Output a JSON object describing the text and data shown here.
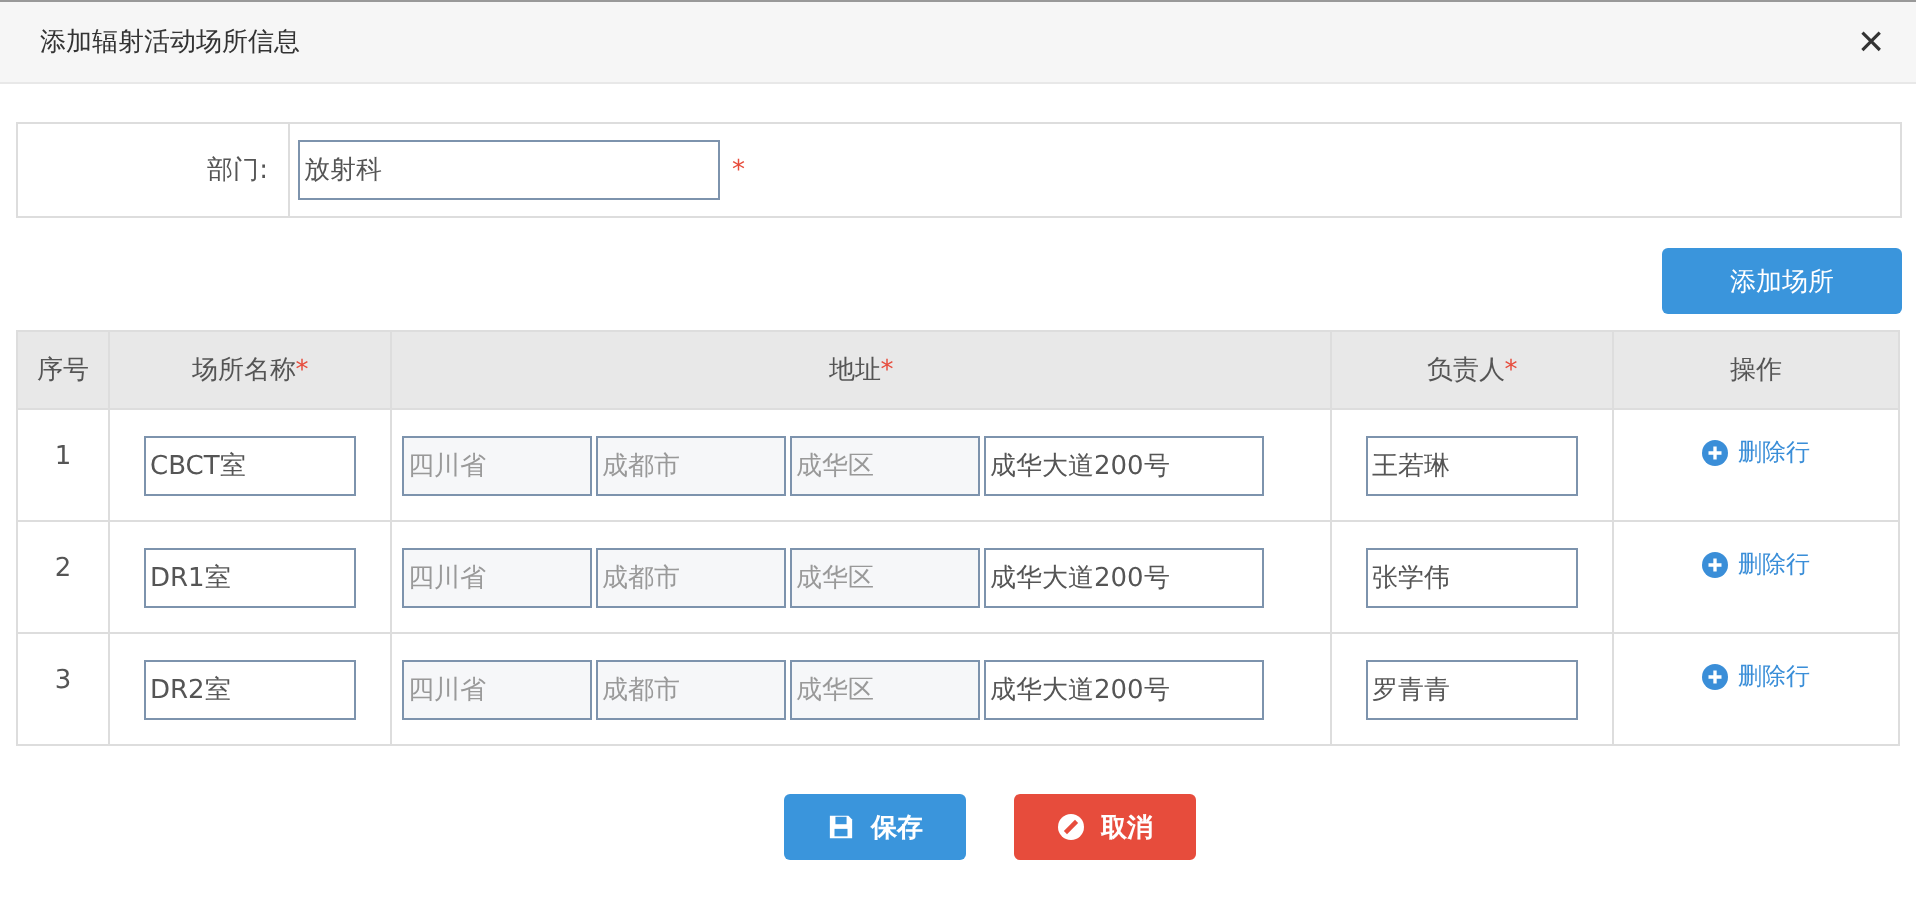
{
  "window": {
    "title": "添加辐射活动场所信息",
    "close": "×"
  },
  "department": {
    "label": "部门:",
    "value": "放射科",
    "mark": "*"
  },
  "add_button": "添加场所",
  "table": {
    "columns": [
      {
        "label": "序号"
      },
      {
        "label": "场所名称",
        "mark": "*"
      },
      {
        "label": "地址",
        "mark": "*"
      },
      {
        "label": "负责人",
        "mark": "*"
      },
      {
        "label": "操作"
      }
    ],
    "rows": [
      {
        "index": "1",
        "name": "CBCT室",
        "address": [
          {
            "value": "四川省",
            "disabled": true
          },
          {
            "value": "成都市",
            "disabled": true
          },
          {
            "value": "成华区",
            "disabled": true
          },
          {
            "value": "成华大道200号",
            "disabled": false
          }
        ],
        "person": "王若琳",
        "action": "删除行"
      },
      {
        "index": "2",
        "name": "DR1室",
        "address": [
          {
            "value": "四川省",
            "disabled": true
          },
          {
            "value": "成都市",
            "disabled": true
          },
          {
            "value": "成华区",
            "disabled": true
          },
          {
            "value": "成华大道200号",
            "disabled": false
          }
        ],
        "person": "张学伟",
        "action": "删除行"
      },
      {
        "index": "3",
        "name": "DR2室",
        "address": [
          {
            "value": "四川省",
            "disabled": true
          },
          {
            "value": "成都市",
            "disabled": true
          },
          {
            "value": "成华区",
            "disabled": true
          },
          {
            "value": "成华大道200号",
            "disabled": false
          }
        ],
        "person": "罗青青",
        "action": "删除行"
      }
    ]
  },
  "buttons": [
    {
      "label": "保存",
      "kind": "save"
    },
    {
      "label": "取消",
      "kind": "cancel"
    }
  ]
}
